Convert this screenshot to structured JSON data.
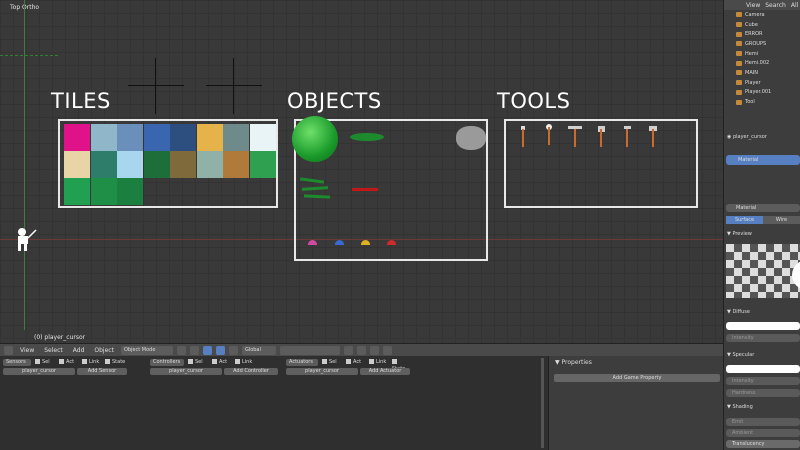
{
  "viewport": {
    "title": "Top Ortho",
    "status": "(0) player_cursor",
    "sections": {
      "tiles": "TILES",
      "objects": "OBJECTS",
      "tools": "TOOLS"
    },
    "tile_colors": [
      "#e0128a",
      "#8fb7c9",
      "#6a8fbb",
      "#3a66b0",
      "#2d4f7f",
      "#e6b24a",
      "#6f8a8a",
      "#e9f4f6",
      "#e9d4a8",
      "#2e7d6b",
      "#a9d6ef",
      "#1e6e3a",
      "#7e6a3a",
      "#8fb1a8",
      "#b07a3a",
      "#2ea050",
      "#20a050",
      "#1f8f47",
      "#1b7f3f"
    ],
    "tool_names": [
      "spear-icon",
      "shovel-icon",
      "pickaxe-icon",
      "axe-icon",
      "hoe-icon",
      "hammer-icon"
    ]
  },
  "outliner": {
    "header": [
      "View",
      "Search",
      "All"
    ],
    "items": [
      "Camera",
      "Cube",
      "ERROR",
      "GROUPS",
      "Hemi",
      "Hemi.002",
      "MAIN",
      "Player",
      "Player.001",
      "Tool"
    ]
  },
  "properties": {
    "object_name": "player_cursor",
    "material_slot": "Material",
    "material_name": "Material",
    "tabs": [
      "Surface",
      "Wire"
    ],
    "preview": "Preview",
    "diffuse": "Diffuse",
    "intensity": "Intensity",
    "specular": "Specular",
    "hardness": "Hardness",
    "shading": "Shading",
    "emit": "Emit",
    "ambient": "Ambient",
    "translucency": "Translucency",
    "colors": {
      "active": "#5680c2",
      "panel": "#3d3d3d"
    }
  },
  "header": {
    "menus": [
      "View",
      "Select",
      "Add",
      "Object"
    ],
    "mode": "Object Mode",
    "orientation": "Global"
  },
  "logic": {
    "sensors": {
      "label": "Sensors",
      "object": "player_cursor",
      "add": "Add Sensor"
    },
    "controllers": {
      "label": "Controllers",
      "object": "player_cursor",
      "add": "Add Controller"
    },
    "actuators": {
      "label": "Actuators",
      "object": "player_cursor",
      "add": "Add Actuator"
    },
    "checks": {
      "sel": "Sel",
      "act": "Act",
      "link": "Link",
      "state": "State"
    },
    "properties_title": "Properties",
    "add_property": "Add Game Property"
  }
}
